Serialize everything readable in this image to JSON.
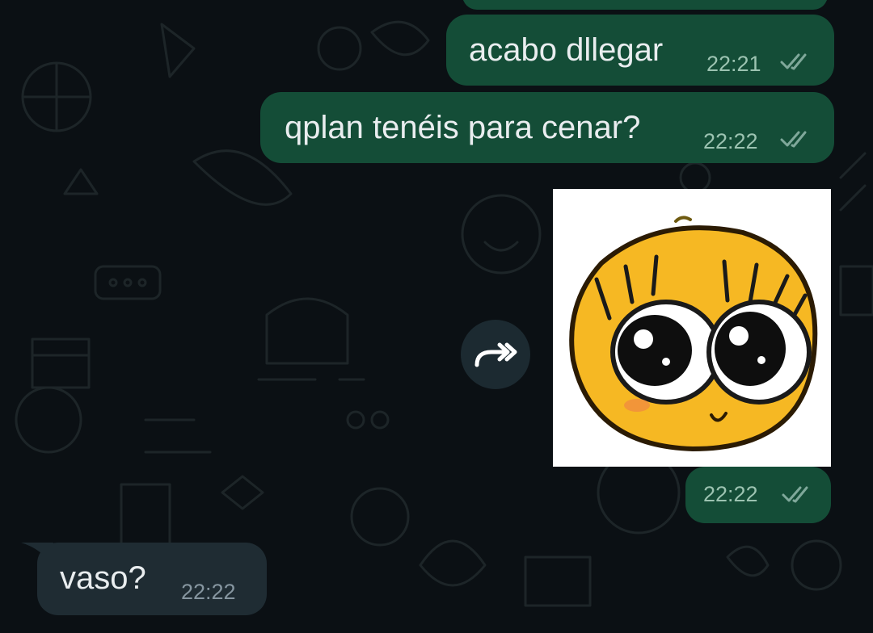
{
  "messages": [
    {
      "direction": "outgoing",
      "text": "acabo dllegar",
      "time": "22:21",
      "status": "read"
    },
    {
      "direction": "outgoing",
      "text": "qplan tenéis para cenar?",
      "time": "22:22",
      "status": "read"
    },
    {
      "direction": "outgoing",
      "type": "sticker",
      "sticker_icon": "shy-yellow-face-sticker",
      "time": "22:22",
      "status": "read"
    },
    {
      "direction": "incoming",
      "text": "vaso?",
      "time": "22:22"
    }
  ],
  "icons": {
    "read_receipt": "double-check-icon",
    "forward": "forward-icon"
  },
  "colors": {
    "background": "#0b1014",
    "outgoing_bubble": "#144d37",
    "incoming_bubble": "#1f2c33",
    "text": "#e9edef",
    "outgoing_time": "#9cc3b1",
    "incoming_time": "#8696a0",
    "read_tick": "#7fa89a"
  }
}
